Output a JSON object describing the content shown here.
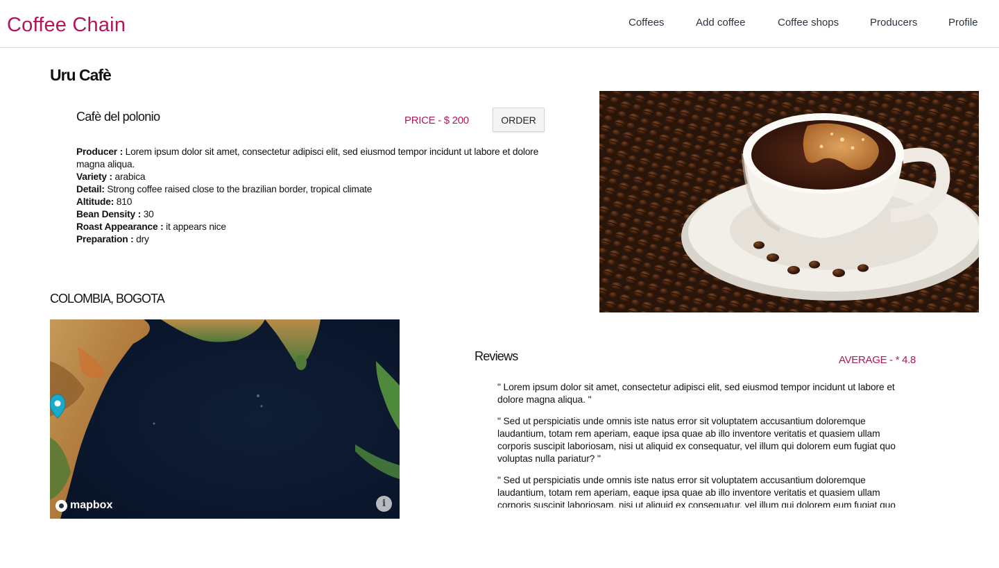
{
  "header": {
    "brand": "Coffee Chain",
    "nav": [
      "Coffees",
      "Add coffee",
      "Coffee shops",
      "Producers",
      "Profile"
    ]
  },
  "shop": {
    "title": "Uru Cafè"
  },
  "coffee": {
    "name": "Cafè del polonio",
    "price_label": "PRICE - $ 200",
    "order_label": "ORDER",
    "details": [
      {
        "label": "Producer :",
        "value": "Lorem ipsum dolor sit amet, consectetur adipisci elit, sed eiusmod tempor incidunt ut labore et dolore magna aliqua."
      },
      {
        "label": "Variety :",
        "value": "arabica"
      },
      {
        "label": "Detail:",
        "value": "Strong coffee raised close to the brazilian border, tropical climate"
      },
      {
        "label": "Altitude:",
        "value": "810"
      },
      {
        "label": "Bean Density :",
        "value": "30"
      },
      {
        "label": "Roast Appearance :",
        "value": "it appears nice"
      },
      {
        "label": "Preparation :",
        "value": "dry"
      }
    ]
  },
  "location": {
    "title": "COLOMBIA, BOGOTA",
    "map_attribution": "mapbox",
    "info_icon": "info-icon"
  },
  "reviews": {
    "title": "Reviews",
    "average_label": "AVERAGE - * 4.8",
    "items": [
      "\" Lorem ipsum dolor sit amet, consectetur adipisci elit, sed eiusmod tempor incidunt ut labore et dolore magna aliqua. \"",
      "\" Sed ut perspiciatis unde omnis iste natus error sit voluptatem accusantium doloremque laudantium, totam rem aperiam, eaque ipsa quae ab illo inventore veritatis et quasiem ullam corporis suscipit laboriosam, nisi ut aliquid ex consequatur, vel illum qui dolorem eum fugiat quo voluptas nulla pariatur? \"",
      "\" Sed ut perspiciatis unde omnis iste natus error sit voluptatem accusantium doloremque laudantium, totam rem aperiam, eaque ipsa quae ab illo inventore veritatis et quasiem ullam corporis suscipit laboriosam, nisi ut aliquid ex consequatur, vel illum qui dolorem eum fugiat quo voluptas nulla pariatur? \""
    ]
  },
  "colors": {
    "accent": "#b3155c",
    "nav_text": "#2b3440"
  }
}
